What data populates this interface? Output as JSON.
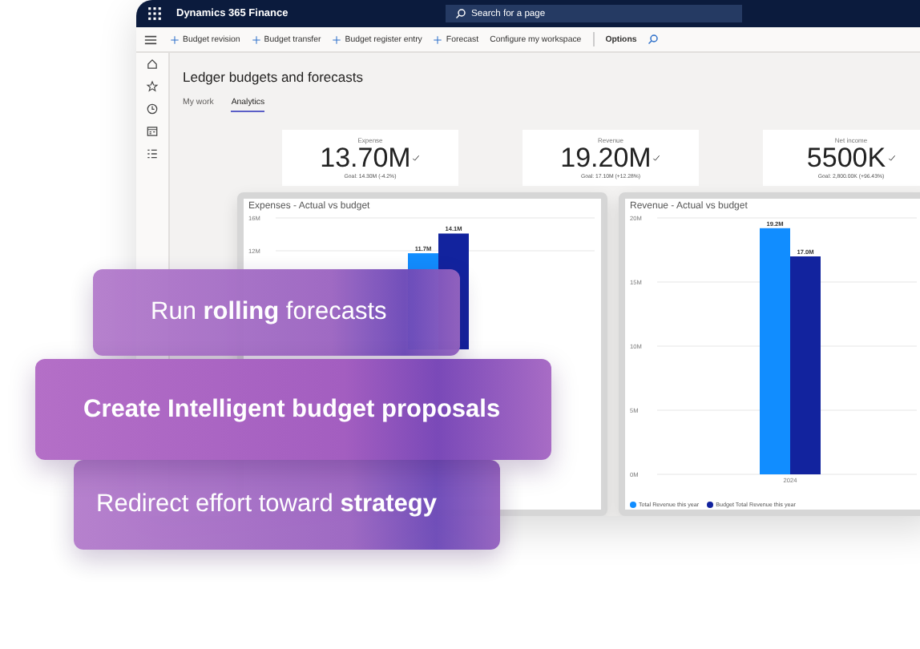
{
  "app": {
    "title": "Dynamics 365 Finance",
    "search": {
      "placeholder": "Search for a page"
    },
    "actions": [
      {
        "label": "Budget revision",
        "kind": "add"
      },
      {
        "label": "Budget transfer",
        "kind": "add"
      },
      {
        "label": "Budget register entry",
        "kind": "add"
      },
      {
        "label": "Forecast",
        "kind": "add"
      },
      {
        "label": "Configure my workspace",
        "kind": "plain"
      },
      {
        "label": "Options",
        "kind": "bold"
      }
    ],
    "page_title": "Ledger budgets and forecasts",
    "tabs": [
      {
        "label": "My work",
        "selected": false
      },
      {
        "label": "Analytics",
        "selected": true
      }
    ],
    "kpis": [
      {
        "label": "Expense",
        "value": "13.70M",
        "goal": "Goal: 14.30M (-4.2%)"
      },
      {
        "label": "Revenue",
        "value": "19.20M",
        "goal": "Goal: 17.10M (+12.28%)"
      },
      {
        "label": "Net income",
        "value": "5500K",
        "goal": "Goal: 2,800.00K (+96.43%)"
      }
    ],
    "charts": [
      {
        "title": "Expenses - Actual vs budget",
        "chart_data": {
          "type": "bar",
          "grid": true,
          "ylim": [
            0,
            16
          ],
          "yticks": [
            {
              "value": 12,
              "label": "12M"
            },
            {
              "value": 16,
              "label": "16M"
            }
          ],
          "data_labels": true,
          "series": [
            {
              "color": "#118dff",
              "values": [
                11.7
              ],
              "value_labels": [
                "11.7M"
              ]
            },
            {
              "color": "#12239e",
              "values": [
                14.1
              ],
              "value_labels": [
                "14.1M"
              ]
            }
          ]
        }
      },
      {
        "title": "Revenue - Actual vs budget",
        "chart_data": {
          "type": "bar",
          "grid": true,
          "categories": [
            "2024"
          ],
          "ylim": [
            0,
            20
          ],
          "yticks": [
            {
              "value": 0,
              "label": "0M"
            },
            {
              "value": 5,
              "label": "5M"
            },
            {
              "value": 10,
              "label": "10M"
            },
            {
              "value": 15,
              "label": "15M"
            },
            {
              "value": 20,
              "label": "20M"
            }
          ],
          "data_labels": true,
          "series": [
            {
              "name": "Total Revenue this year",
              "color": "#118dff",
              "values": [
                19.2
              ],
              "value_labels": [
                "19.2M"
              ]
            },
            {
              "name": "Budget Total Revenue this year",
              "color": "#12239e",
              "values": [
                17.0
              ],
              "value_labels": [
                "17.0M"
              ]
            }
          ]
        }
      }
    ]
  },
  "promos": [
    {
      "text": "Run **rolling** forecasts",
      "highlighted": false
    },
    {
      "text": "Create Intelligent budget proposals",
      "highlighted": true
    },
    {
      "text": "Redirect effort toward **strategy**",
      "highlighted": false
    }
  ]
}
